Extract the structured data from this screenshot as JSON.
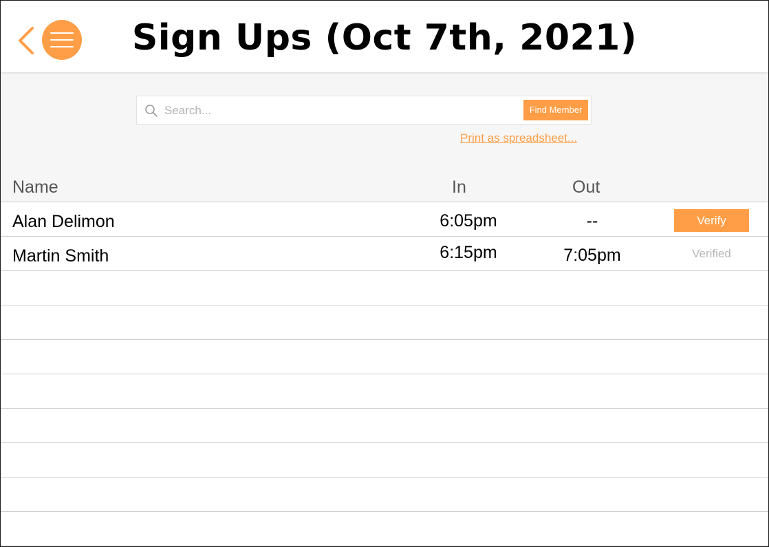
{
  "header": {
    "title": "Sign Ups (Oct 7th, 2021)"
  },
  "search": {
    "placeholder": "Search...",
    "value": "",
    "button_label": "Find Member"
  },
  "print_link": "Print as spreadsheet...",
  "table": {
    "columns": [
      "Name",
      "In",
      "Out"
    ],
    "rows": [
      {
        "name": "Alan Delimon",
        "in": "6:05pm",
        "out": "--",
        "action": "Verify"
      },
      {
        "name": "Martin Smith",
        "in": "6:15pm",
        "out": "7:05pm",
        "status": "Verified"
      }
    ]
  },
  "colors": {
    "accent": "#ff9e46",
    "panel_background": "#f6f6f6",
    "muted_text": "#b8b8b8"
  },
  "icons": {
    "back": "chevron-left-icon",
    "menu": "hamburger-menu-icon",
    "search": "search-icon"
  }
}
